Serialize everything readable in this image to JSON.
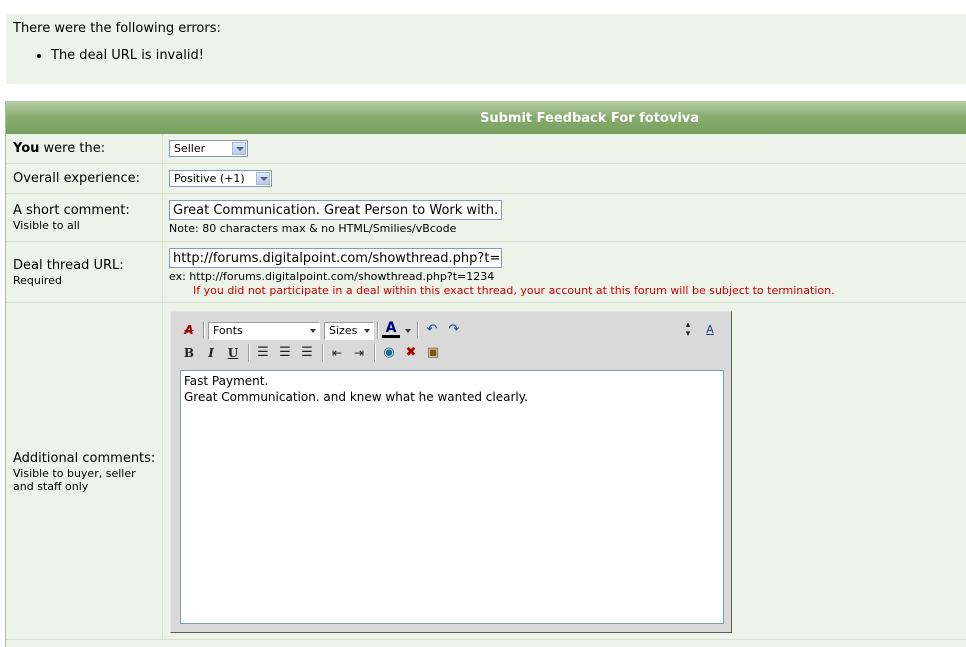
{
  "errors": {
    "title": "There were the following errors:",
    "items": [
      "The deal URL is invalid!"
    ]
  },
  "form": {
    "header": "Submit Feedback For fotoviva",
    "role": {
      "label_bold": "You",
      "label_rest": " were the:",
      "value": "Seller"
    },
    "experience": {
      "label": "Overall experience:",
      "value": "Positive (+1)"
    },
    "short_comment": {
      "label": "A short comment:",
      "sublabel": "Visible to all",
      "value": "Great Communication. Great Person to Work with.",
      "note": "Note: 80 characters max & no HTML/Smilies/vBcode"
    },
    "deal_url": {
      "label": "Deal thread URL:",
      "sublabel": "Required",
      "value": "http://forums.digitalpoint.com/showthread.php?t=",
      "example": "ex: http://forums.digitalpoint.com/showthread.php?t=1234",
      "warning": "If you did not participate in a deal within this exact thread, your account at this forum will be subject to termination."
    },
    "additional": {
      "label": "Additional comments:",
      "sublabel_1": "Visible to buyer, seller",
      "sublabel_2": "and staff only",
      "text": "Fast Payment.\nGreat Communication. and knew what he wanted clearly."
    }
  },
  "editor_toolbar": {
    "fonts": "Fonts",
    "sizes": "Sizes",
    "bold": "B",
    "italic": "I",
    "underline": "U",
    "font_color_letter": "A",
    "font_color": "#000080"
  },
  "colors": {
    "header_green": "#76a05c",
    "panel_bg": "#edf3e9",
    "warning_red": "#cc0000"
  }
}
